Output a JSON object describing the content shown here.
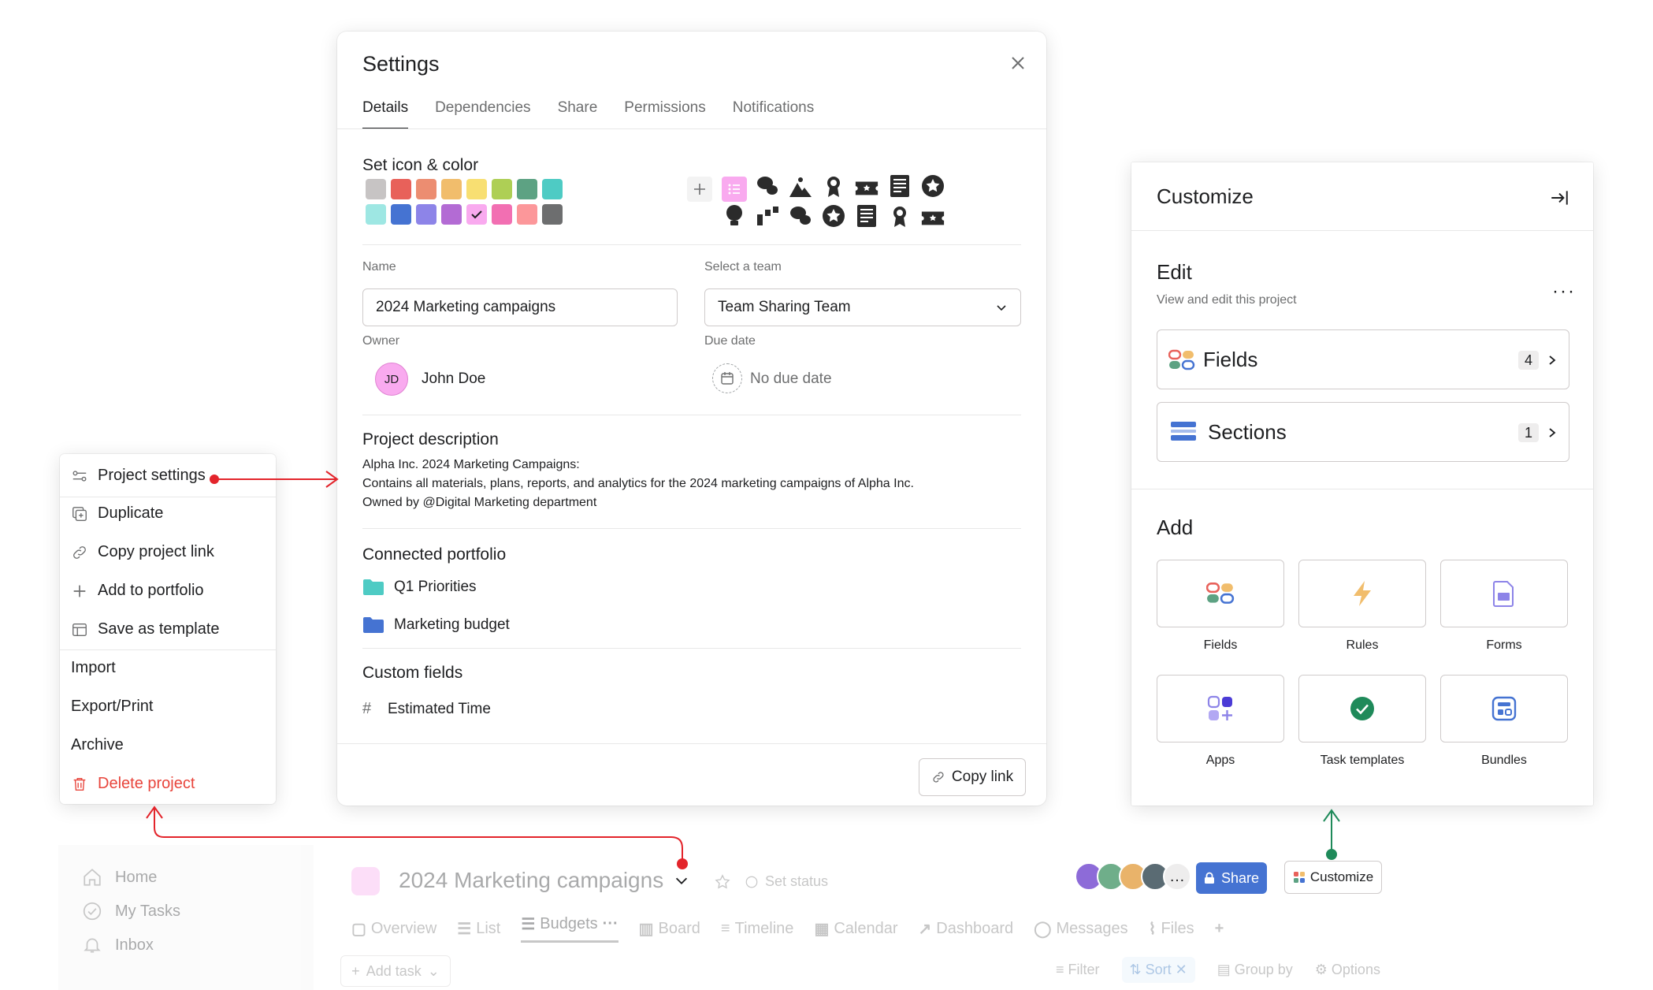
{
  "background_app": {
    "sidebar": [
      {
        "label": "Home",
        "icon": "home-icon"
      },
      {
        "label": "My Tasks",
        "icon": "check-circle-icon"
      },
      {
        "label": "Inbox",
        "icon": "bell-icon"
      }
    ],
    "project_title": "2024 Marketing campaigns",
    "set_status": "Set status",
    "tabs": [
      {
        "label": "Overview",
        "icon": "clipboard-icon"
      },
      {
        "label": "List",
        "icon": "list-icon"
      },
      {
        "label": "Budgets",
        "icon": "list-icon",
        "active": true
      },
      {
        "label": "Board",
        "icon": "board-icon"
      },
      {
        "label": "Timeline",
        "icon": "timeline-icon"
      },
      {
        "label": "Calendar",
        "icon": "calendar-icon"
      },
      {
        "label": "Dashboard",
        "icon": "chart-icon"
      },
      {
        "label": "Messages",
        "icon": "message-icon"
      },
      {
        "label": "Files",
        "icon": "paperclip-icon"
      }
    ],
    "add_task": "Add task",
    "toolbar": {
      "filter": "Filter",
      "sort": "Sort",
      "group_by": "Group by",
      "options": "Options"
    }
  },
  "header_actions": {
    "share": "Share",
    "customize": "Customize",
    "avatar_colors": [
      "#8d6bd8",
      "#6fae8a",
      "#e9b36a",
      "#5a6b73"
    ],
    "more": "…"
  },
  "context_menu": {
    "items": [
      {
        "label": "Project settings",
        "icon": "sliders-icon"
      },
      {
        "label": "Duplicate",
        "icon": "duplicate-icon"
      },
      {
        "label": "Copy project link",
        "icon": "link-icon"
      },
      {
        "label": "Add to portfolio",
        "icon": "plus-icon"
      },
      {
        "label": "Save as template",
        "icon": "template-icon"
      },
      {
        "label": "Import"
      },
      {
        "label": "Export/Print"
      },
      {
        "label": "Archive"
      },
      {
        "label": "Delete project",
        "icon": "trash-icon",
        "danger": true
      }
    ]
  },
  "settings": {
    "title": "Settings",
    "tabs": [
      "Details",
      "Dependencies",
      "Share",
      "Permissions",
      "Notifications"
    ],
    "active_tab": "Details",
    "icon_color_label": "Set icon & color",
    "colors": [
      "#c7c4c4",
      "#e8615a",
      "#ec8d71",
      "#f1bd6c",
      "#f8df72",
      "#aecf55",
      "#5da283",
      "#4ecbc4",
      "#9ee7e3",
      "#4573d2",
      "#8d84e8",
      "#b36bd4",
      "#f9aaef",
      "#f26fb2",
      "#fc979a",
      "#6d6e6f"
    ],
    "selected_color": "#f9aaef",
    "name_label": "Name",
    "name_value": "2024 Marketing campaigns",
    "team_label": "Select a team",
    "team_value": "Team Sharing Team",
    "owner_label": "Owner",
    "owner_initials": "JD",
    "owner_name": "John Doe",
    "due_label": "Due date",
    "due_value": "No due date",
    "description_label": "Project description",
    "description_lines": [
      "Alpha Inc. 2024 Marketing Campaigns:",
      "Contains all materials, plans, reports, and analytics for the 2024 marketing campaigns of Alpha Inc.",
      "Owned by @Digital Marketing department"
    ],
    "portfolio_label": "Connected portfolio",
    "portfolios": [
      {
        "name": "Q1 Priorities",
        "color": "#4ecbc4"
      },
      {
        "name": "Marketing budget",
        "color": "#4573d2"
      }
    ],
    "custom_fields_label": "Custom fields",
    "custom_fields": [
      "Estimated Time"
    ],
    "copy_link": "Copy link"
  },
  "customize": {
    "title": "Customize",
    "edit_title": "Edit",
    "edit_subtitle": "View and edit this project",
    "edit_rows": [
      {
        "label": "Fields",
        "count": "4"
      },
      {
        "label": "Sections",
        "count": "1"
      }
    ],
    "add_title": "Add",
    "add_items": [
      "Fields",
      "Rules",
      "Forms",
      "Apps",
      "Task templates",
      "Bundles"
    ]
  }
}
